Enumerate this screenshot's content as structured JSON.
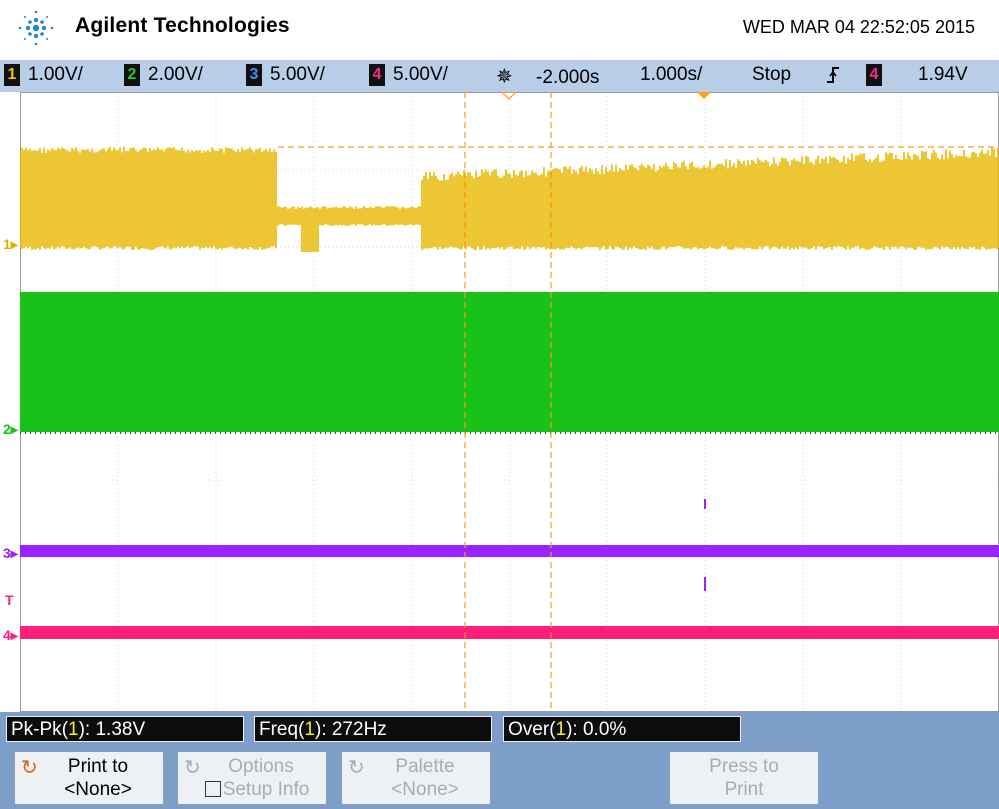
{
  "header": {
    "brand": "Agilent Technologies",
    "datetime": "WED MAR 04 22:52:05 2015"
  },
  "status": {
    "ch1": {
      "num": "1",
      "scale": "1.00V/",
      "color": "#f5c400"
    },
    "ch2": {
      "num": "2",
      "scale": "2.00V/",
      "color": "#22cc22"
    },
    "ch3": {
      "num": "3",
      "scale": "5.00V/",
      "color": "#3c8cff"
    },
    "ch4": {
      "num": "4",
      "scale": "5.00V/",
      "color": "#ff2a8c"
    },
    "delay": "-2.000s",
    "timebase": "1.000s/",
    "run_state": "Stop",
    "trigger_edge_icon": "rising-edge-icon",
    "trigger_source": "4",
    "trigger_level": "1.94V"
  },
  "channel_markers": {
    "m1": "1",
    "m2": "2",
    "m3": "3",
    "mt": "T",
    "m4": "4"
  },
  "measurements": [
    {
      "name": "Pk-Pk",
      "channel": "1",
      "value": ": 1.38V"
    },
    {
      "name": "Freq",
      "channel": "1",
      "value": ": 272Hz"
    },
    {
      "name": "Over",
      "channel": "1",
      "value": ": 0.0%"
    }
  ],
  "softkeys": {
    "print": {
      "line1": "Print to",
      "line2": "<None>"
    },
    "options": {
      "line1": "Options",
      "line2": "Setup Info"
    },
    "palette": {
      "line1": "Palette",
      "line2": "<None>"
    },
    "press": {
      "line1": "Press to",
      "line2": "Print"
    }
  },
  "colors": {
    "ch1": "#e8b800",
    "ch2": "#19c219",
    "ch3": "#9a22ff",
    "ch4": "#ff1f7a",
    "cursor": "#ff9a1a",
    "grid": "#d6d6d6"
  }
}
